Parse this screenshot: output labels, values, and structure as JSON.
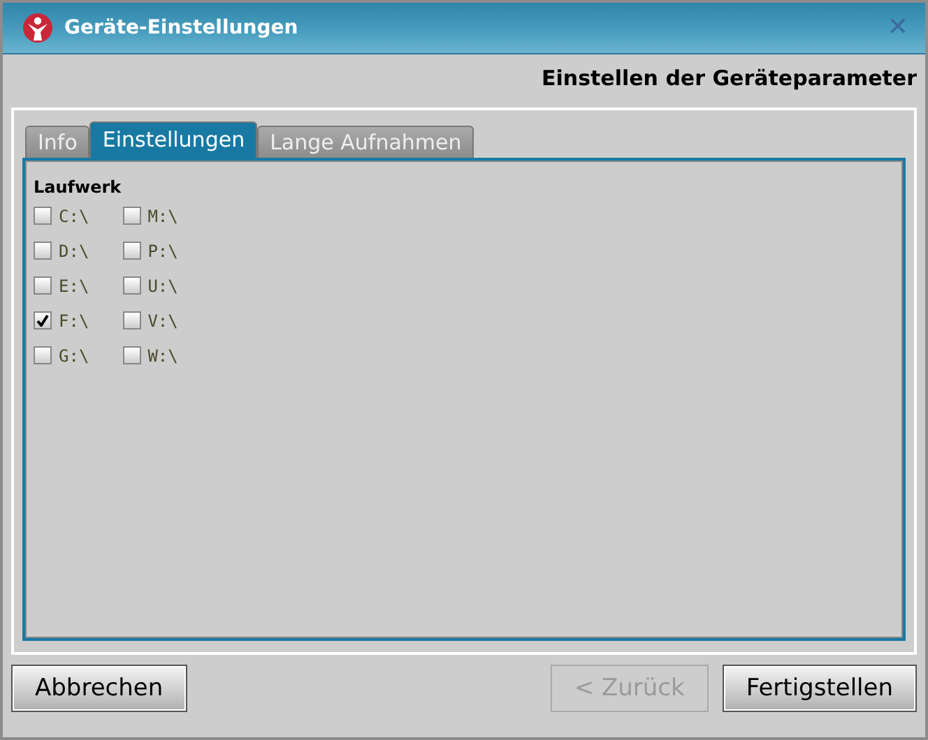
{
  "window": {
    "title": "Geräte-Einstellungen",
    "close": "✕"
  },
  "header": "Einstellen der Geräteparameter",
  "tabs": [
    {
      "label": "Info",
      "selected": false
    },
    {
      "label": "Einstellungen",
      "selected": true
    },
    {
      "label": "Lange Aufnahmen",
      "selected": false
    }
  ],
  "group_label": "Laufwerk",
  "drive_columns": [
    [
      {
        "label": "C:\\",
        "checked": false
      },
      {
        "label": "D:\\",
        "checked": false
      },
      {
        "label": "E:\\",
        "checked": false
      },
      {
        "label": "F:\\",
        "checked": true
      },
      {
        "label": "G:\\",
        "checked": false
      }
    ],
    [
      {
        "label": "M:\\",
        "checked": false
      },
      {
        "label": "P:\\",
        "checked": false
      },
      {
        "label": "U:\\",
        "checked": false
      },
      {
        "label": "V:\\",
        "checked": false
      },
      {
        "label": "W:\\",
        "checked": false
      }
    ]
  ],
  "buttons": [
    {
      "label": "Abbrechen",
      "disabled": false
    },
    {
      "label": "< Zurück",
      "disabled": true
    },
    {
      "label": "Fertigstellen",
      "disabled": false
    }
  ]
}
